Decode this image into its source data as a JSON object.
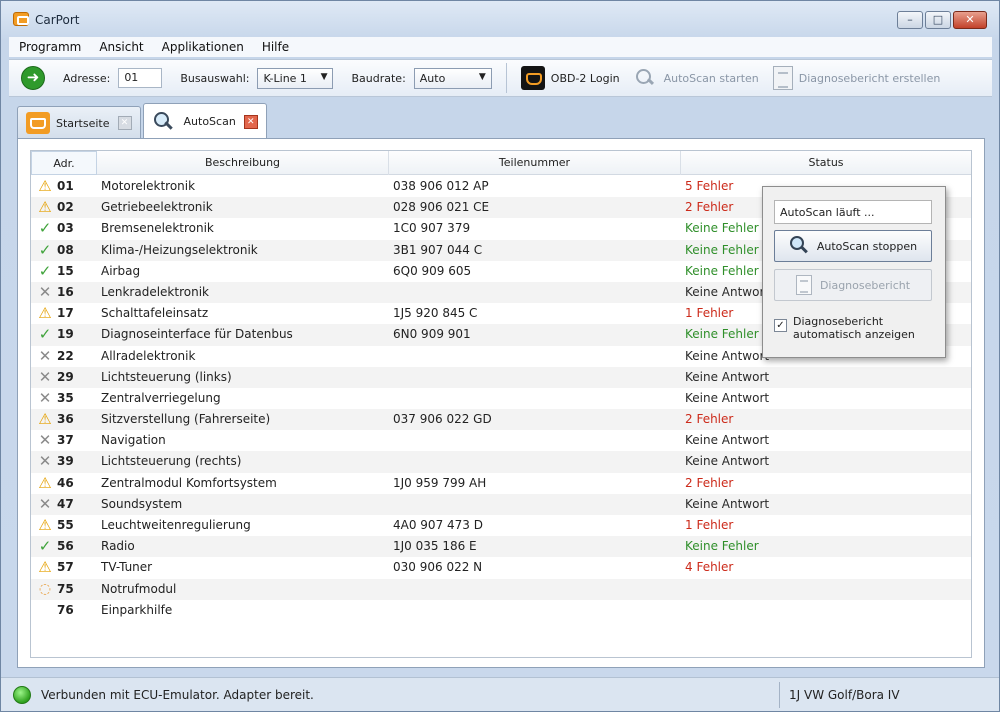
{
  "window": {
    "title": "CarPort"
  },
  "menu": [
    "Programm",
    "Ansicht",
    "Applikationen",
    "Hilfe"
  ],
  "toolbar": {
    "address_label": "Adresse:",
    "address_value": "01",
    "bus_label": "Busauswahl:",
    "bus_value": "K-Line 1",
    "baud_label": "Baudrate:",
    "baud_value": "Auto",
    "obd_login": "OBD-2 Login",
    "autoscan_start": "AutoScan starten",
    "report_create": "Diagnosebericht erstellen"
  },
  "tabs": [
    {
      "label": "Startseite"
    },
    {
      "label": "AutoScan"
    }
  ],
  "table": {
    "headers": {
      "adr": "Adr.",
      "desc": "Beschreibung",
      "part": "Teilenummer",
      "status": "Status"
    },
    "rows": [
      {
        "icon": "warning",
        "adr": "01",
        "desc": "Motorelektronik",
        "part": "038 906 012 AP",
        "status": "5 Fehler",
        "tone": "red"
      },
      {
        "icon": "warning",
        "adr": "02",
        "desc": "Getriebeelektronik",
        "part": "028 906 021 CE",
        "status": "2 Fehler",
        "tone": "red"
      },
      {
        "icon": "ok",
        "adr": "03",
        "desc": "Bremsenelektronik",
        "part": "1C0 907 379",
        "status": "Keine Fehler",
        "tone": "green"
      },
      {
        "icon": "ok",
        "adr": "08",
        "desc": "Klima-/Heizungselektronik",
        "part": "3B1 907 044 C",
        "status": "Keine Fehler",
        "tone": "green"
      },
      {
        "icon": "ok",
        "adr": "15",
        "desc": "Airbag",
        "part": "6Q0 909 605",
        "status": "Keine Fehler",
        "tone": "green"
      },
      {
        "icon": "none",
        "adr": "16",
        "desc": "Lenkradelektronik",
        "part": "",
        "status": "Keine Antwort",
        "tone": "plain"
      },
      {
        "icon": "warning",
        "adr": "17",
        "desc": "Schalttafeleinsatz",
        "part": "1J5 920 845 C",
        "status": "1 Fehler",
        "tone": "red"
      },
      {
        "icon": "ok",
        "adr": "19",
        "desc": "Diagnoseinterface für Datenbus",
        "part": "6N0 909 901",
        "status": "Keine Fehler",
        "tone": "green"
      },
      {
        "icon": "none",
        "adr": "22",
        "desc": "Allradelektronik",
        "part": "",
        "status": "Keine Antwort",
        "tone": "plain"
      },
      {
        "icon": "none",
        "adr": "29",
        "desc": "Lichtsteuerung (links)",
        "part": "",
        "status": "Keine Antwort",
        "tone": "plain"
      },
      {
        "icon": "none",
        "adr": "35",
        "desc": "Zentralverriegelung",
        "part": "",
        "status": "Keine Antwort",
        "tone": "plain"
      },
      {
        "icon": "warning",
        "adr": "36",
        "desc": "Sitzverstellung (Fahrerseite)",
        "part": "037 906 022 GD",
        "status": "2 Fehler",
        "tone": "red"
      },
      {
        "icon": "none",
        "adr": "37",
        "desc": "Navigation",
        "part": "",
        "status": "Keine Antwort",
        "tone": "plain"
      },
      {
        "icon": "none",
        "adr": "39",
        "desc": "Lichtsteuerung (rechts)",
        "part": "",
        "status": "Keine Antwort",
        "tone": "plain"
      },
      {
        "icon": "warning",
        "adr": "46",
        "desc": "Zentralmodul Komfortsystem",
        "part": "1J0 959 799 AH",
        "status": "2 Fehler",
        "tone": "red"
      },
      {
        "icon": "none",
        "adr": "47",
        "desc": "Soundsystem",
        "part": "",
        "status": "Keine Antwort",
        "tone": "plain"
      },
      {
        "icon": "warning",
        "adr": "55",
        "desc": "Leuchtweitenregulierung",
        "part": "4A0 907 473 D",
        "status": "1 Fehler",
        "tone": "red"
      },
      {
        "icon": "ok",
        "adr": "56",
        "desc": "Radio",
        "part": "1J0 035 186 E",
        "status": "Keine Fehler",
        "tone": "green"
      },
      {
        "icon": "warning",
        "adr": "57",
        "desc": "TV-Tuner",
        "part": "030 906 022 N",
        "status": "4 Fehler",
        "tone": "red"
      },
      {
        "icon": "busy",
        "adr": "75",
        "desc": "Notrufmodul",
        "part": "",
        "status": "",
        "tone": "plain"
      },
      {
        "icon": "blank",
        "adr": "76",
        "desc": "Einparkhilfe",
        "part": "",
        "status": "",
        "tone": "plain"
      }
    ]
  },
  "overlay": {
    "status": "AutoScan läuft ...",
    "stop_label": "AutoScan stoppen",
    "report_label": "Diagnosebericht",
    "auto_show_label": "Diagnosebericht automatisch anzeigen",
    "auto_show_checked": true
  },
  "statusbar": {
    "connection": "Verbunden mit ECU-Emulator. Adapter bereit.",
    "vehicle": "1J VW Golf/Bora IV"
  },
  "colors": {
    "error": "#cc2a1a",
    "ok": "#2f8f2a",
    "warning": "#e5a000",
    "connected": "#2fa11e",
    "brand": "#f29c24"
  }
}
